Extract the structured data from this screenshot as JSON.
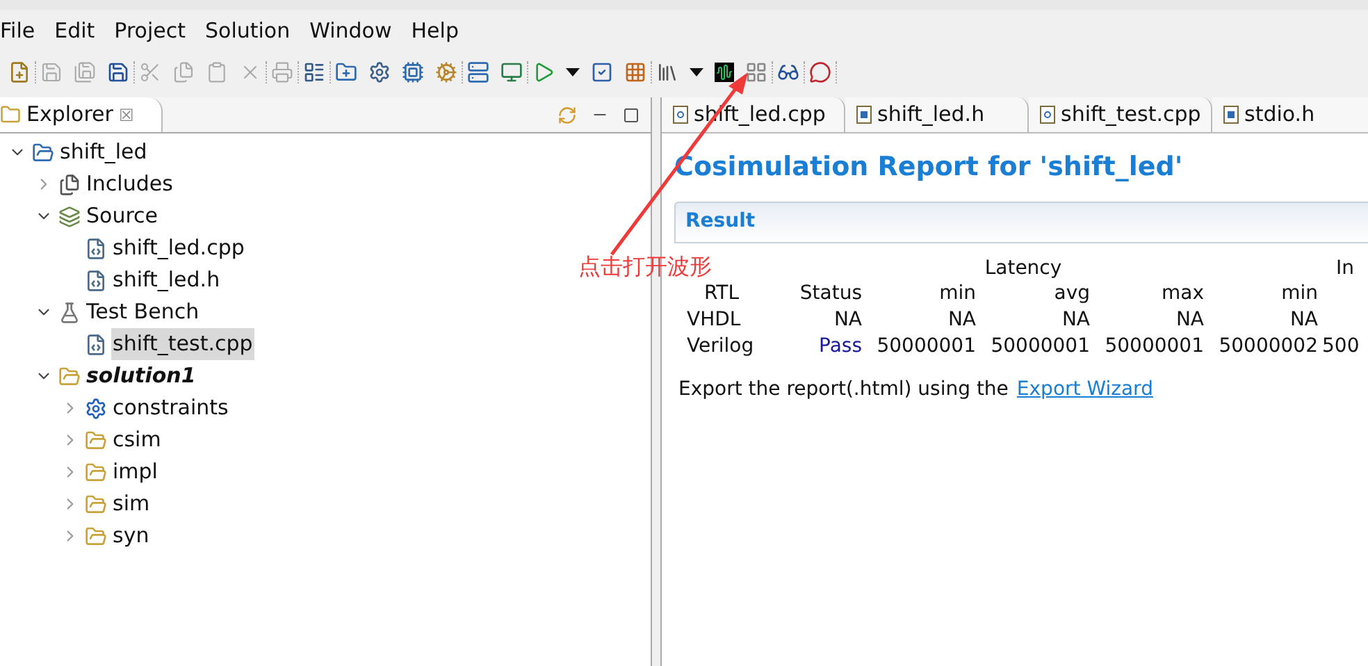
{
  "menu": [
    {
      "label": "File"
    },
    {
      "label": "Edit"
    },
    {
      "label": "Project"
    },
    {
      "label": "Solution"
    },
    {
      "label": "Window"
    },
    {
      "label": "Help"
    }
  ],
  "toolbar": [
    [
      {
        "kind": "new",
        "disabled": false
      }
    ],
    [
      {
        "kind": "save",
        "disabled": true
      },
      {
        "kind": "save_all",
        "disabled": true
      },
      {
        "kind": "save_as",
        "disabled": false
      }
    ],
    [
      {
        "kind": "cut",
        "disabled": true
      },
      {
        "kind": "copy",
        "disabled": true
      },
      {
        "kind": "paste",
        "disabled": true
      },
      {
        "kind": "delete",
        "disabled": true
      }
    ],
    [
      {
        "kind": "print",
        "disabled": true
      }
    ],
    [
      {
        "kind": "properties",
        "disabled": false
      }
    ],
    [
      {
        "kind": "new_solution",
        "disabled": false
      },
      {
        "kind": "settings",
        "disabled": false
      },
      {
        "kind": "directive",
        "disabled": false
      },
      {
        "kind": "cogs",
        "disabled": false
      }
    ],
    [
      {
        "kind": "csim",
        "disabled": false
      },
      {
        "kind": "synth",
        "disabled": false
      }
    ],
    [
      {
        "kind": "run",
        "disabled": false
      },
      {
        "kind": "dropdown",
        "disabled": false
      },
      {
        "kind": "check",
        "disabled": false
      },
      {
        "kind": "grid",
        "disabled": false
      }
    ],
    [
      {
        "kind": "library",
        "disabled": false
      },
      {
        "kind": "dropdown",
        "disabled": false
      },
      {
        "kind": "waveform",
        "disabled": false
      },
      {
        "kind": "compare",
        "disabled": false
      }
    ],
    [
      {
        "kind": "glasses",
        "disabled": false
      }
    ],
    [
      {
        "kind": "sigma",
        "disabled": false
      }
    ]
  ],
  "explorer": {
    "title": "Explorer",
    "close": "☒",
    "tree": [
      {
        "label": "shift_led",
        "kind": "project",
        "expanded": true,
        "bold": false,
        "selected": false,
        "children": [
          {
            "label": "Includes",
            "kind": "includes",
            "expanded": false,
            "bold": false,
            "selected": false
          },
          {
            "label": "Source",
            "kind": "source",
            "expanded": true,
            "bold": false,
            "selected": false,
            "children": [
              {
                "label": "shift_led.cpp",
                "kind": "file",
                "bold": false,
                "selected": false
              },
              {
                "label": "shift_led.h",
                "kind": "file",
                "bold": false,
                "selected": false
              }
            ]
          },
          {
            "label": "Test Bench",
            "kind": "testbench",
            "expanded": true,
            "bold": false,
            "selected": false,
            "children": [
              {
                "label": "shift_test.cpp",
                "kind": "file",
                "bold": false,
                "selected": true
              }
            ]
          },
          {
            "label": "solution1",
            "kind": "solution",
            "expanded": true,
            "bold": true,
            "selected": false,
            "children": [
              {
                "label": "constraints",
                "kind": "gear",
                "expanded": false,
                "bold": false,
                "selected": false
              },
              {
                "label": "csim",
                "kind": "folder",
                "expanded": false,
                "bold": false,
                "selected": false
              },
              {
                "label": "impl",
                "kind": "folder",
                "expanded": false,
                "bold": false,
                "selected": false
              },
              {
                "label": "sim",
                "kind": "folder",
                "expanded": false,
                "bold": false,
                "selected": false
              },
              {
                "label": "syn",
                "kind": "folder",
                "expanded": false,
                "bold": false,
                "selected": false
              }
            ]
          }
        ]
      }
    ]
  },
  "editor_tabs": [
    {
      "label": "shift_led.cpp",
      "kind": "c"
    },
    {
      "label": "shift_led.h",
      "kind": "h"
    },
    {
      "label": "shift_test.cpp",
      "kind": "c"
    },
    {
      "label": "stdio.h",
      "kind": "h"
    }
  ],
  "report": {
    "title": "Cosimulation Report for 'shift_led'",
    "section": "Result",
    "group_headers": [
      "Latency",
      "In"
    ],
    "columns": [
      "RTL",
      "Status",
      "min",
      "avg",
      "max",
      "min"
    ],
    "rows": [
      {
        "cells": [
          "VHDL",
          "NA",
          "NA",
          "NA",
          "NA",
          "NA"
        ],
        "pass": false
      },
      {
        "cells": [
          "Verilog",
          "Pass",
          "50000001",
          "50000001",
          "50000001",
          "50000002",
          "500"
        ],
        "pass": true
      }
    ],
    "export_text": "Export the report(.html) using the",
    "export_link": "Export Wizard"
  },
  "annotation": "点击打开波形"
}
